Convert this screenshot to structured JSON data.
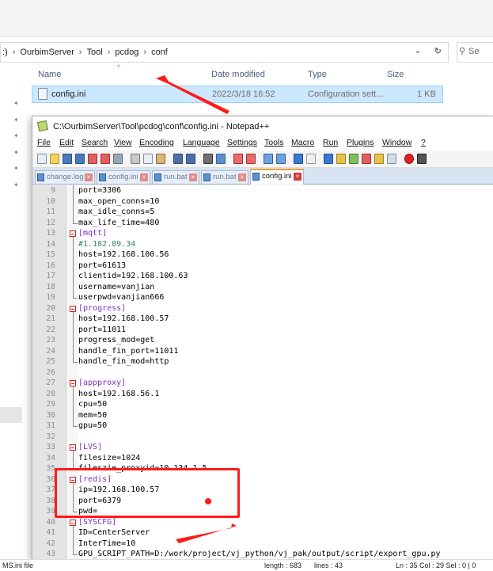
{
  "explorer": {
    "breadcrumb": [
      ":)",
      "OurbimServer",
      "Tool",
      "pcdog",
      "conf"
    ],
    "search_placeholder": "Se",
    "columns": {
      "name": "Name",
      "date_modified": "Date modified",
      "type": "Type",
      "size": "Size"
    },
    "file": {
      "name": "config.ini",
      "date": "2022/3/18 16:52",
      "type": "Configuration sett...",
      "size": "1 KB"
    },
    "status_left": "MS.ini file"
  },
  "notepad": {
    "title": "C:\\OurbimServer\\Tool\\pcdog\\conf\\config.ini - Notepad++",
    "menu": [
      "File",
      "Edit",
      "Search",
      "View",
      "Encoding",
      "Language",
      "Settings",
      "Tools",
      "Macro",
      "Run",
      "Plugins",
      "Window",
      "?"
    ],
    "tabs": [
      {
        "label": "change.log",
        "active": false
      },
      {
        "label": "config.ini",
        "active": false
      },
      {
        "label": "run.bat",
        "active": false
      },
      {
        "label": "run.bat",
        "active": false
      },
      {
        "label": "config.ini",
        "active": true
      }
    ],
    "lines": [
      {
        "n": "9",
        "text": "port=3306",
        "kind": "kv"
      },
      {
        "n": "10",
        "text": "max_open_conns=10",
        "kind": "kv"
      },
      {
        "n": "11",
        "text": "max_idle_conns=5",
        "kind": "kv"
      },
      {
        "n": "12",
        "text": "max_life_time=480",
        "kind": "kv"
      },
      {
        "n": "13",
        "text": "[mqtt]",
        "kind": "section"
      },
      {
        "n": "14",
        "text": "#1.182.89.34",
        "kind": "comment"
      },
      {
        "n": "15",
        "text": "host=192.168.100.56",
        "kind": "kv"
      },
      {
        "n": "16",
        "text": "port=61613",
        "kind": "kv"
      },
      {
        "n": "17",
        "text": "clientid=192.168.100.63",
        "kind": "kv"
      },
      {
        "n": "18",
        "text": "username=vanjian",
        "kind": "kv"
      },
      {
        "n": "19",
        "text": "userpwd=vanjian666",
        "kind": "kv"
      },
      {
        "n": "20",
        "text": "[progress]",
        "kind": "section"
      },
      {
        "n": "21",
        "text": "host=192.168.100.57",
        "kind": "kv"
      },
      {
        "n": "22",
        "text": "port=11011",
        "kind": "kv"
      },
      {
        "n": "23",
        "text": "progress_mod=get",
        "kind": "kv"
      },
      {
        "n": "24",
        "text": "handle_fin_port=11011",
        "kind": "kv"
      },
      {
        "n": "25",
        "text": "handle_fin_mod=http",
        "kind": "kv"
      },
      {
        "n": "26",
        "text": "",
        "kind": "blank"
      },
      {
        "n": "27",
        "text": "[appproxy]",
        "kind": "section"
      },
      {
        "n": "28",
        "text": "host=192.168.56.1",
        "kind": "kv"
      },
      {
        "n": "29",
        "text": "cpu=50",
        "kind": "kv"
      },
      {
        "n": "30",
        "text": "mem=50",
        "kind": "kv"
      },
      {
        "n": "31",
        "text": "gpu=50",
        "kind": "kv"
      },
      {
        "n": "32",
        "text": "",
        "kind": "blank"
      },
      {
        "n": "33",
        "text": "[LVS]",
        "kind": "section"
      },
      {
        "n": "34",
        "text": "filesize=1024",
        "kind": "kv"
      },
      {
        "n": "35",
        "text": "fileszie_proxyid=10.134.1.5",
        "kind": "kv"
      },
      {
        "n": "36",
        "text": "[redis]",
        "kind": "section"
      },
      {
        "n": "37",
        "text": "ip=192.168.100.57",
        "kind": "kv"
      },
      {
        "n": "38",
        "text": "port=6379",
        "kind": "kv"
      },
      {
        "n": "39",
        "text": "pwd=",
        "kind": "kv"
      },
      {
        "n": "40",
        "text": "[SYSCFG]",
        "kind": "section"
      },
      {
        "n": "41",
        "text": "ID=CenterServer",
        "kind": "kv"
      },
      {
        "n": "42",
        "text": "InterTime=10",
        "kind": "kv"
      },
      {
        "n": "43",
        "text": "GPU_SCRIPT_PATH=D:/work/project/vj_python/vj_pak/output/script/export_gpu.py",
        "kind": "kv"
      }
    ],
    "status": {
      "length": "length : 683",
      "lines": "lines : 43",
      "pos": "Ln : 35    Col : 29    Sel : 0 | 0"
    }
  },
  "colors": {
    "annotation": "#ff1a1a",
    "section": "#7d2ec4",
    "comment": "#2e8b57",
    "selection": "#cce8ff"
  }
}
